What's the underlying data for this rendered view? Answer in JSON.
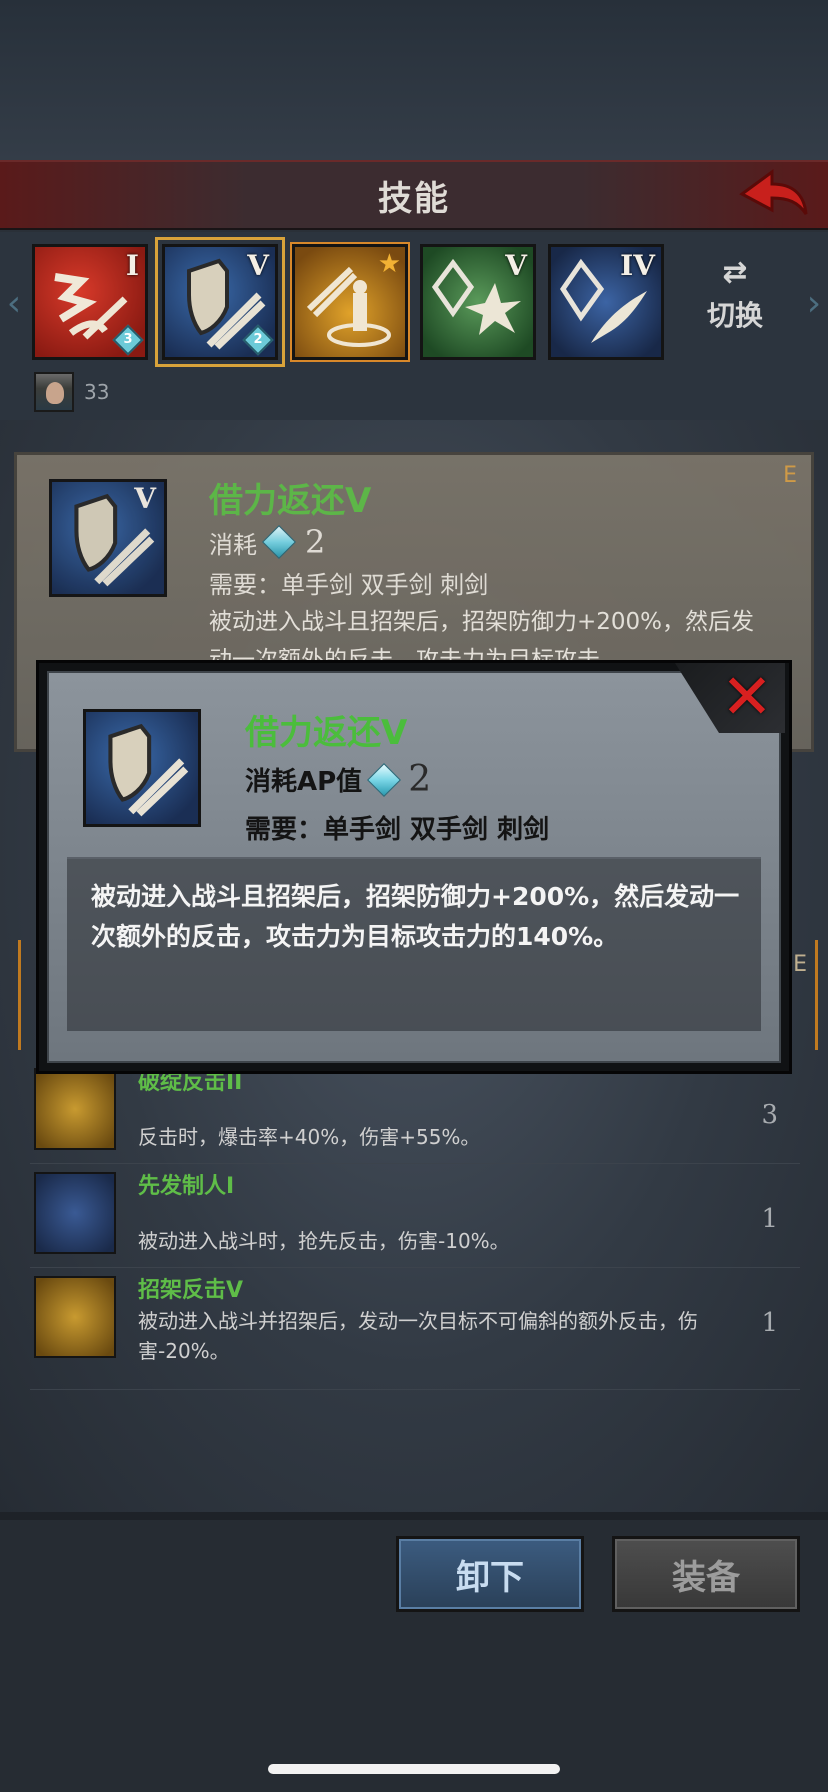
{
  "header": {
    "title": "技能"
  },
  "slots": [
    {
      "rank": "I",
      "gem_count": "3"
    },
    {
      "rank": "V",
      "gem_count": "2"
    },
    {
      "rank": ""
    },
    {
      "rank": "V"
    },
    {
      "rank": "IV"
    }
  ],
  "switch_label": "切换",
  "hero": {
    "count": "33"
  },
  "detail": {
    "corner_tag": "E",
    "rank": "V",
    "name": "借力返还V",
    "cost_label": "消耗",
    "cost_value": "2",
    "requires": "需要：单手剑  双手剑  刺剑",
    "description": "被动进入战斗且招架后，招架防御力+200%，然后发动一次额外的反击，攻击力为目标攻击"
  },
  "partial_frame_tag": "E",
  "equip_list": [
    {
      "name": "破绽反击II",
      "desc": "反击时，爆击率+40%，伤害+55%。",
      "count": "3"
    },
    {
      "name": "先发制人I",
      "desc": "被动进入战斗时，抢先反击，伤害-10%。",
      "count": "1"
    },
    {
      "name": "招架反击V",
      "desc": "被动进入战斗并招架后，发动一次目标不可偏斜的额外反击，伤害-20%。",
      "count": "1"
    }
  ],
  "buttons": {
    "unequip": "卸下",
    "equip": "装备"
  },
  "modal": {
    "name": "借力返还V",
    "cost_label": "消耗AP值",
    "cost_value": "2",
    "requires": "需要：单手剑  双手剑  刺剑",
    "description": "被动进入战斗且招架后，招架防御力+200%，然后发动一次额外的反击，攻击力为目标攻击力的140%。"
  },
  "colors": {
    "skill_name": "#4bbd3c",
    "selected_outline": "#d8a23a",
    "close_x": "#d82020"
  },
  "icons": [
    "back-arrow-icon",
    "switch-arrows-icon",
    "diamond-icon",
    "close-x-icon",
    "shield-sword-icon"
  ]
}
